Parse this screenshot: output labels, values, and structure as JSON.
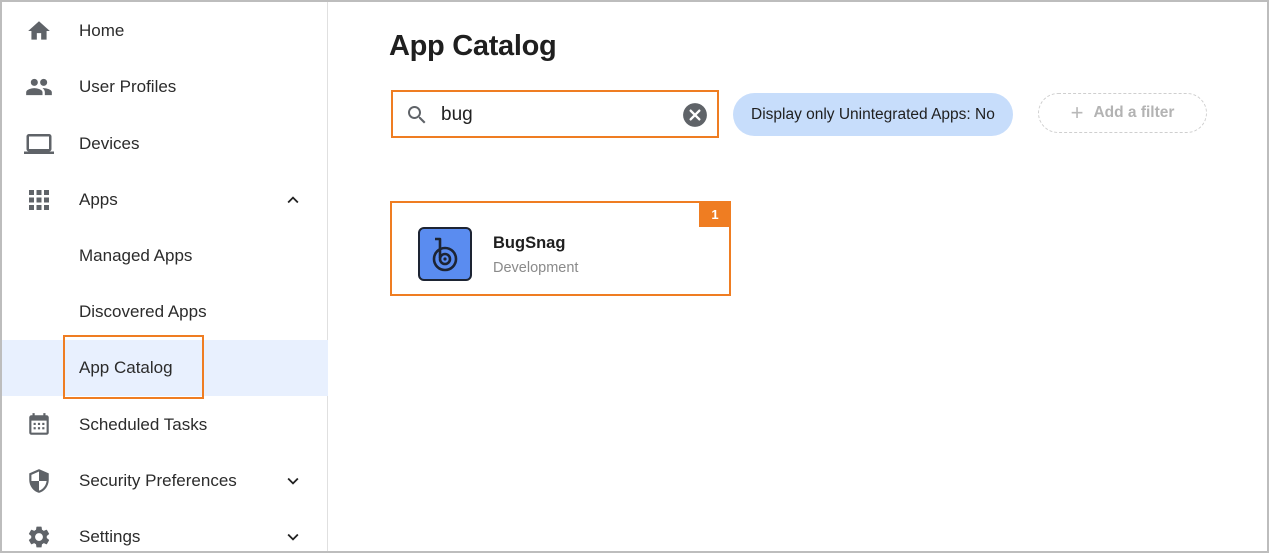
{
  "sidebar": {
    "items": [
      {
        "label": "Home",
        "icon": "home-icon"
      },
      {
        "label": "User Profiles",
        "icon": "people-icon"
      },
      {
        "label": "Devices",
        "icon": "laptop-icon"
      },
      {
        "label": "Apps",
        "icon": "grid-icon",
        "expanded": true
      },
      {
        "label": "Managed Apps"
      },
      {
        "label": "Discovered Apps"
      },
      {
        "label": "App Catalog",
        "active": true
      },
      {
        "label": "Scheduled Tasks",
        "icon": "calendar-icon"
      },
      {
        "label": "Security Preferences",
        "icon": "shield-icon",
        "expanded": false
      },
      {
        "label": "Settings",
        "icon": "gear-icon",
        "expanded": false
      }
    ]
  },
  "main": {
    "title": "App Catalog",
    "search": {
      "value": "bug",
      "placeholder": ""
    },
    "filter_chip": "Display only Unintegrated Apps: No",
    "add_filter": "Add a filter",
    "results": [
      {
        "name": "BugSnag",
        "category": "Development",
        "badge": "1",
        "logo_color": "#5a8cf0"
      }
    ]
  },
  "colors": {
    "highlight": "#ef7d22",
    "active_bg": "#e8f0fe",
    "chip_bg": "#c7ddfb",
    "icon": "#5f6368"
  }
}
